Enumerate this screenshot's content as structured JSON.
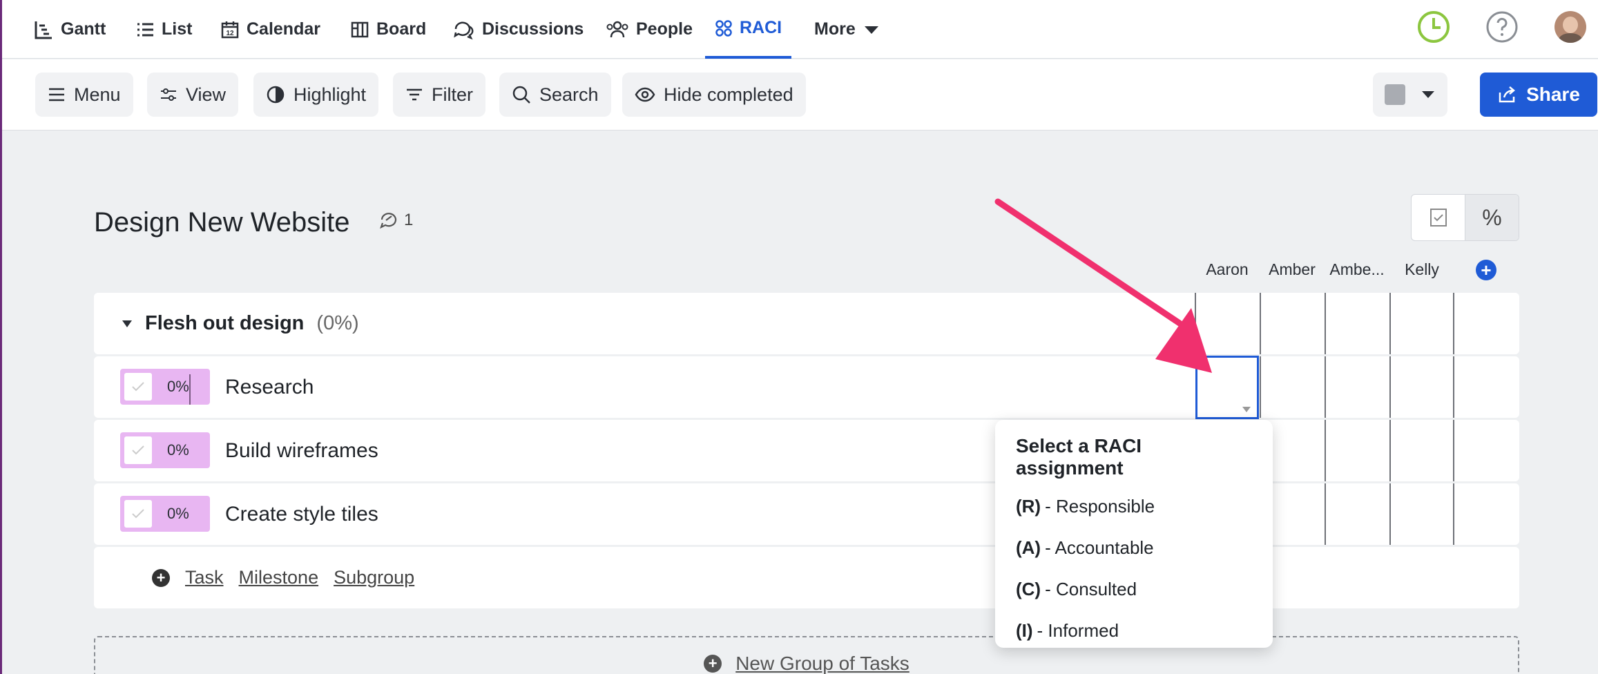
{
  "nav": {
    "items": [
      {
        "label": "Gantt",
        "icon": "gantt-icon"
      },
      {
        "label": "List",
        "icon": "list-icon"
      },
      {
        "label": "Calendar",
        "icon": "calendar-icon"
      },
      {
        "label": "Board",
        "icon": "board-icon"
      },
      {
        "label": "Discussions",
        "icon": "discussions-icon"
      },
      {
        "label": "People",
        "icon": "people-icon"
      },
      {
        "label": "RACI",
        "icon": "raci-icon"
      },
      {
        "label": "More",
        "icon": "chevron-down-icon"
      }
    ],
    "active": "RACI",
    "calendar_icon_number": "12"
  },
  "toolbar": {
    "menu": "Menu",
    "view": "View",
    "highlight": "Highlight",
    "filter": "Filter",
    "search": "Search",
    "hide_completed": "Hide completed",
    "share": "Share"
  },
  "project": {
    "title": "Design New Website",
    "comment_count": "1"
  },
  "columns": [
    "Aaron",
    "Amber",
    "Ambe...",
    "Kelly"
  ],
  "group": {
    "name": "Flesh out design",
    "percent": "(0%)"
  },
  "tasks": [
    {
      "name": "Research",
      "percent": "0%"
    },
    {
      "name": "Build wireframes",
      "percent": "0%"
    },
    {
      "name": "Create style tiles",
      "percent": "0%"
    }
  ],
  "add_links": {
    "task": "Task",
    "milestone": "Milestone",
    "subgroup": "Subgroup"
  },
  "new_group": "New Group of Tasks",
  "raci_popup": {
    "title": "Select a RACI assignment",
    "options": [
      {
        "code": "(R)",
        "label": "- Responsible"
      },
      {
        "code": "(A)",
        "label": "- Accountable"
      },
      {
        "code": "(C)",
        "label": "- Consulted"
      },
      {
        "code": "(I)",
        "label": "- Informed"
      }
    ]
  },
  "colors": {
    "accent": "#1f5bd6",
    "progress_fill": "#e8b6f2",
    "arrow": "#f0306e",
    "clock": "#8cc63f"
  }
}
